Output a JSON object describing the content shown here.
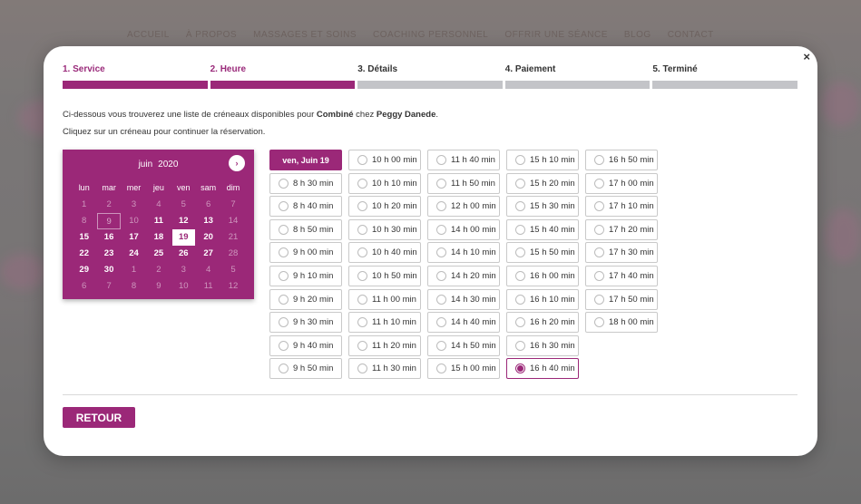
{
  "background": {
    "nav": [
      "ACCUEIL",
      "À PROPOS",
      "MASSAGES ET SOINS",
      "COACHING PERSONNEL",
      "OFFRIR UNE SÉANCE",
      "BLOG",
      "CONTACT"
    ]
  },
  "modal": {
    "close_label": "×",
    "steps": [
      {
        "label": "1. Service",
        "active": true
      },
      {
        "label": "2. Heure",
        "active": true
      },
      {
        "label": "3. Détails",
        "active": false
      },
      {
        "label": "4. Paiement",
        "active": false
      },
      {
        "label": "5. Terminé",
        "active": false
      }
    ],
    "intro": {
      "line1_prefix": "Ci-dessous vous trouverez une liste de créneaux disponibles pour ",
      "service": "Combiné",
      "line1_mid": " chez ",
      "staff": "Peggy Danede",
      "line1_suffix": ".",
      "line2": "Cliquez sur un créneau pour continuer la réservation."
    },
    "calendar": {
      "month": "juin",
      "year": "2020",
      "next_icon": "›",
      "weekdays": [
        "lun",
        "mar",
        "mer",
        "jeu",
        "ven",
        "sam",
        "dim"
      ],
      "days": [
        {
          "d": "1",
          "s": "muted"
        },
        {
          "d": "2",
          "s": "muted"
        },
        {
          "d": "3",
          "s": "muted"
        },
        {
          "d": "4",
          "s": "muted"
        },
        {
          "d": "5",
          "s": "muted"
        },
        {
          "d": "6",
          "s": "muted"
        },
        {
          "d": "7",
          "s": "muted"
        },
        {
          "d": "8",
          "s": "muted"
        },
        {
          "d": "9",
          "s": "today"
        },
        {
          "d": "10",
          "s": "muted"
        },
        {
          "d": "11",
          "s": "avail"
        },
        {
          "d": "12",
          "s": "avail"
        },
        {
          "d": "13",
          "s": "avail"
        },
        {
          "d": "14",
          "s": "muted"
        },
        {
          "d": "15",
          "s": "avail"
        },
        {
          "d": "16",
          "s": "avail"
        },
        {
          "d": "17",
          "s": "avail"
        },
        {
          "d": "18",
          "s": "avail"
        },
        {
          "d": "19",
          "s": "selected"
        },
        {
          "d": "20",
          "s": "avail"
        },
        {
          "d": "21",
          "s": "muted"
        },
        {
          "d": "22",
          "s": "avail"
        },
        {
          "d": "23",
          "s": "avail"
        },
        {
          "d": "24",
          "s": "avail"
        },
        {
          "d": "25",
          "s": "avail"
        },
        {
          "d": "26",
          "s": "avail"
        },
        {
          "d": "27",
          "s": "avail"
        },
        {
          "d": "28",
          "s": "muted"
        },
        {
          "d": "29",
          "s": "avail"
        },
        {
          "d": "30",
          "s": "avail"
        },
        {
          "d": "1",
          "s": "muted"
        },
        {
          "d": "2",
          "s": "muted"
        },
        {
          "d": "3",
          "s": "muted"
        },
        {
          "d": "4",
          "s": "muted"
        },
        {
          "d": "5",
          "s": "muted"
        },
        {
          "d": "6",
          "s": "muted"
        },
        {
          "d": "7",
          "s": "muted"
        },
        {
          "d": "8",
          "s": "muted"
        },
        {
          "d": "9",
          "s": "muted"
        },
        {
          "d": "10",
          "s": "muted"
        },
        {
          "d": "11",
          "s": "muted"
        },
        {
          "d": "12",
          "s": "muted"
        }
      ]
    },
    "day_header": "ven, Juin 19",
    "slots": [
      "8 h 30 min",
      "8 h 40 min",
      "8 h 50 min",
      "9 h 00 min",
      "9 h 10 min",
      "9 h 20 min",
      "9 h 30 min",
      "9 h 40 min",
      "9 h 50 min",
      "10 h 00 min",
      "10 h 10 min",
      "10 h 20 min",
      "10 h 30 min",
      "10 h 40 min",
      "10 h 50 min",
      "11 h 00 min",
      "11 h 10 min",
      "11 h 20 min",
      "11 h 30 min",
      "11 h 40 min",
      "11 h 50 min",
      "12 h 00 min",
      "14 h 00 min",
      "14 h 10 min",
      "14 h 20 min",
      "14 h 30 min",
      "14 h 40 min",
      "14 h 50 min",
      "15 h 00 min",
      "15 h 10 min",
      "15 h 20 min",
      "15 h 30 min",
      "15 h 40 min",
      "15 h 50 min",
      "16 h 00 min",
      "16 h 10 min",
      "16 h 20 min",
      "16 h 30 min",
      "16 h 40 min",
      "16 h 50 min",
      "17 h 00 min",
      "17 h 10 min",
      "17 h 20 min",
      "17 h 30 min",
      "17 h 40 min",
      "17 h 50 min",
      "18 h 00 min"
    ],
    "selected_slot": "16 h 40 min",
    "back_label": "RETOUR",
    "accent_color": "#9b2878"
  }
}
